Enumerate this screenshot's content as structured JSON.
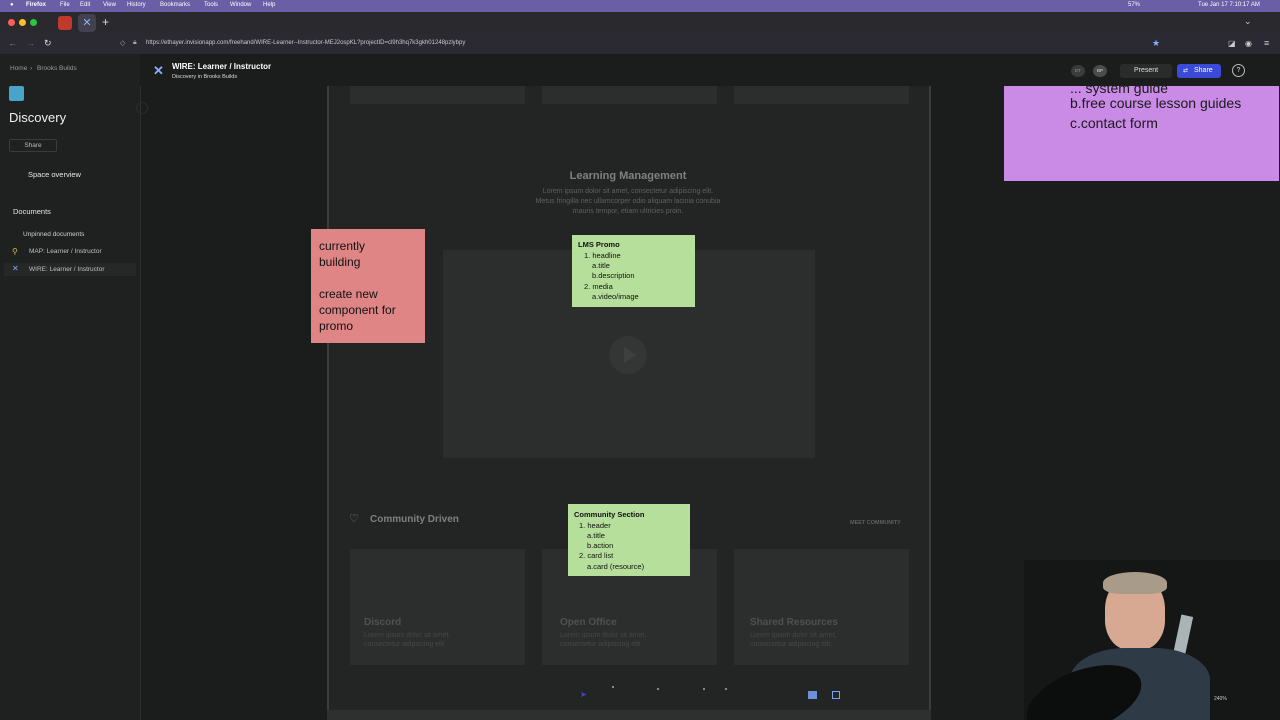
{
  "menubar": {
    "app": "Firefox",
    "items": [
      "File",
      "Edit",
      "View",
      "History",
      "Bookmarks",
      "Tools",
      "Window",
      "Help"
    ],
    "battery": "57%",
    "clock": "Tue Jan 17  7:10:17 AM"
  },
  "browser": {
    "url": "https://ethayer.invisionapp.com/freehand/WIRE-Learner--Instructor-MEJ2ospKL?projectID=cl9h3hq7k3gkh01248pzlybpy"
  },
  "header": {
    "title": "WIRE: Learner / Instructor",
    "subtitle": "Discovery in Brooks Builds",
    "avatar1": "ET",
    "avatar2": "BP",
    "present_label": "Present",
    "share_label": "Share"
  },
  "sidebar": {
    "breadcrumb_home": "Home",
    "breadcrumb_sep": "›",
    "breadcrumb_space": "Brooks Builds",
    "space_title": "Discovery",
    "share_label": "Share",
    "overview_label": "Space overview",
    "documents_label": "Documents",
    "unpinned_label": "Unpinned documents",
    "docs": [
      {
        "label": "MAP: Learner / Instructor"
      },
      {
        "label": "WIRE: Learner / Instructor"
      }
    ]
  },
  "canvas": {
    "purple_note": {
      "line0": "... system guide",
      "line1": "b.free course lesson guides",
      "line2": "c.contact form"
    },
    "lm_section": {
      "title": "Learning Management",
      "body1": "Lorem ipsum dolor sit amet, consectetur adipiscing elit.",
      "body2": "Metus fringilla nec ullamcorper odio aliquam lacinia conubia",
      "body3": "mauris tempor, etiam ultricies proin."
    },
    "red_note": {
      "line1": "currently",
      "line2": "building",
      "line3": "create new",
      "line4": "component for",
      "line5": "promo"
    },
    "lms_note": {
      "title": "LMS Promo",
      "l1": "1. headline",
      "l2": "a.title",
      "l3": "b.description",
      "l4": "2. media",
      "l5": "a.video/image"
    },
    "community": {
      "title": "Community Driven",
      "meet": "MEET COMMUNITY",
      "cards": [
        {
          "title": "Discord",
          "body1": "Lorem ipsum dolor sit amet,",
          "body2": "consectetur adipiscing elit."
        },
        {
          "title": "Open Office",
          "body1": "Lorem ipsum dolor sit amet,",
          "body2": "consectetur adipiscing elit."
        },
        {
          "title": "Shared Resources",
          "body1": "Lorem ipsum dolor sit amet,",
          "body2": "consectetur adipiscing elit."
        }
      ]
    },
    "community_note": {
      "title": "Community Section",
      "l1": "1. header",
      "l2": "a.title",
      "l3": "b.action",
      "l4": "2. card list",
      "l5": "a.card (resource)"
    },
    "zoom": "240%"
  },
  "colors": {
    "menubar": "#6a5fa6",
    "share_button": "#3b4bd8",
    "red_note": "#e08585",
    "green_note": "#b7df9c",
    "purple_note": "#c98be6"
  }
}
